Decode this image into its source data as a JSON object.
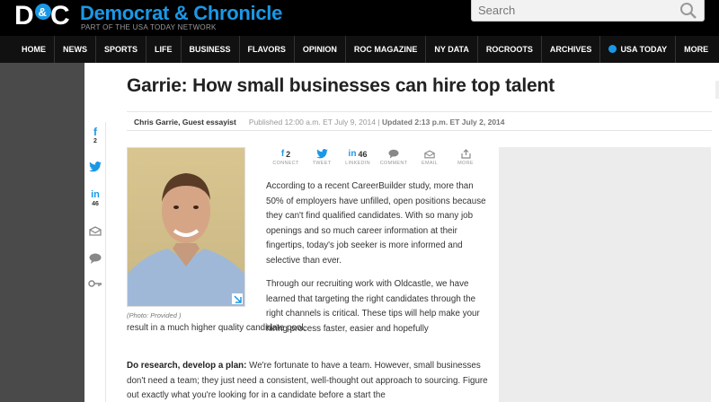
{
  "header": {
    "logo_text": "D&C",
    "brand": "Democrat & Chronicle",
    "tagline": "PART OF THE USA TODAY NETWORK",
    "search_placeholder": "Search",
    "brand_color": "#1a98e6"
  },
  "nav": {
    "items": [
      "HOME",
      "NEWS",
      "SPORTS",
      "LIFE",
      "BUSINESS",
      "FLAVORS",
      "OPINION",
      "ROC MAGAZINE",
      "NY DATA",
      "ROCROOTS",
      "ARCHIVES",
      "USA TODAY",
      "MORE"
    ]
  },
  "article": {
    "headline": "Garrie: How small businesses can hire top talent",
    "author": "Chris Garrie, Guest essayist",
    "published": "Published 12:00 a.m. ET July 9, 2014",
    "separator": "|",
    "updated": "Updated 2:13 p.m. ET July 2, 2014",
    "photo_caption": "(Photo: Provided )",
    "para1": "According to a recent CareerBuilder study, more than 50% of employers have unfilled, open positions because they can't find qualified candidates. With so many job openings and so much career information at their fingertips, today's job seeker is more informed and selective than ever.",
    "para2_a": "Through our recruiting work with Oldcastle, we have learned that targeting the right candidates through the right channels is critical. These tips will help make your hiring process faster, easier and hopefully",
    "para2_b": "result in a much higher quality candidate pool.",
    "para3_lead": "Do research, develop a plan:",
    "para3_text": " We're fortunate to have a team. However, small businesses don't need a team; they just need a consistent, well-thought out approach to sourcing. Figure out exactly what you're looking for in a candidate before a start the"
  },
  "share_rail": {
    "facebook_count": "2",
    "linkedin_count": "46"
  },
  "toolbar": {
    "items": [
      {
        "label": "CONNECT",
        "icon": "facebook-icon",
        "count": "2"
      },
      {
        "label": "TWEET",
        "icon": "twitter-icon",
        "count": ""
      },
      {
        "label": "LINKEDIN",
        "icon": "linkedin-icon",
        "count": "46"
      },
      {
        "label": "COMMENT",
        "icon": "comment-icon",
        "count": ""
      },
      {
        "label": "EMAIL",
        "icon": "email-icon",
        "count": ""
      },
      {
        "label": "MORE",
        "icon": "more-icon",
        "count": ""
      }
    ]
  }
}
